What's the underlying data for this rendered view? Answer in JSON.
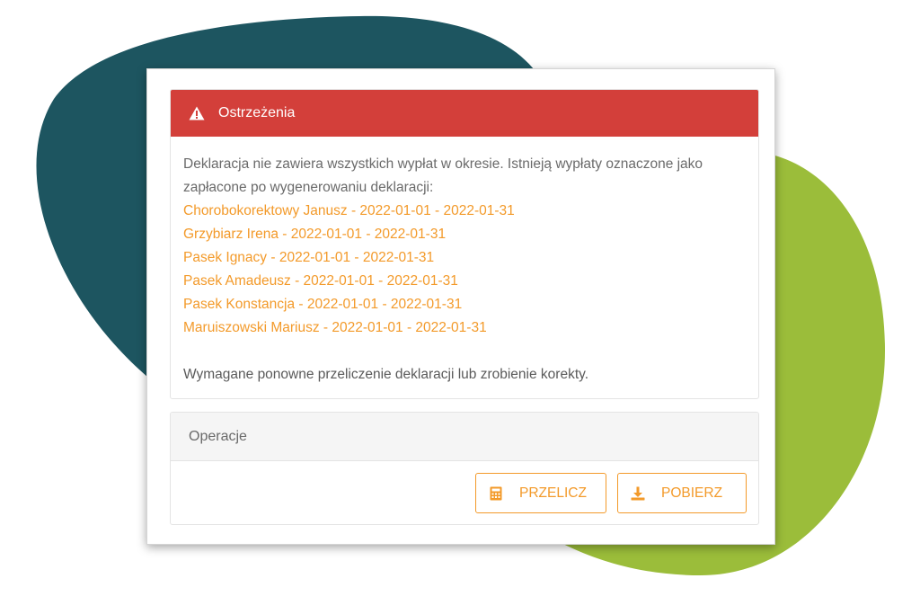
{
  "colors": {
    "blob_dark": "#1d5560",
    "blob_green": "#9bbd3a",
    "alert_red": "#d33f3a",
    "accent_orange": "#f39a2a"
  },
  "alert": {
    "icon": "warning-triangle-icon",
    "title": "Ostrzeżenia",
    "message": "Deklaracja nie zawiera wszystkich wypłat w okresie. Istnieją wypłaty oznaczone jako zapłacone po wygenerowaniu deklaracji:",
    "items": [
      "Chorobokorektowy Janusz - 2022-01-01 - 2022-01-31",
      "Grzybiarz Irena - 2022-01-01 - 2022-01-31",
      "Pasek Ignacy - 2022-01-01 - 2022-01-31",
      "Pasek Amadeusz - 2022-01-01 - 2022-01-31",
      "Pasek Konstancja - 2022-01-01 - 2022-01-31",
      "Maruiszowski Mariusz - 2022-01-01 - 2022-01-31"
    ],
    "footer": "Wymagane ponowne przeliczenie deklaracji lub zrobienie korekty."
  },
  "operations": {
    "title": "Operacje",
    "recalculate": {
      "label": "PRZELICZ",
      "icon": "calculator-icon"
    },
    "download": {
      "label": "POBIERZ",
      "icon": "download-icon"
    }
  }
}
